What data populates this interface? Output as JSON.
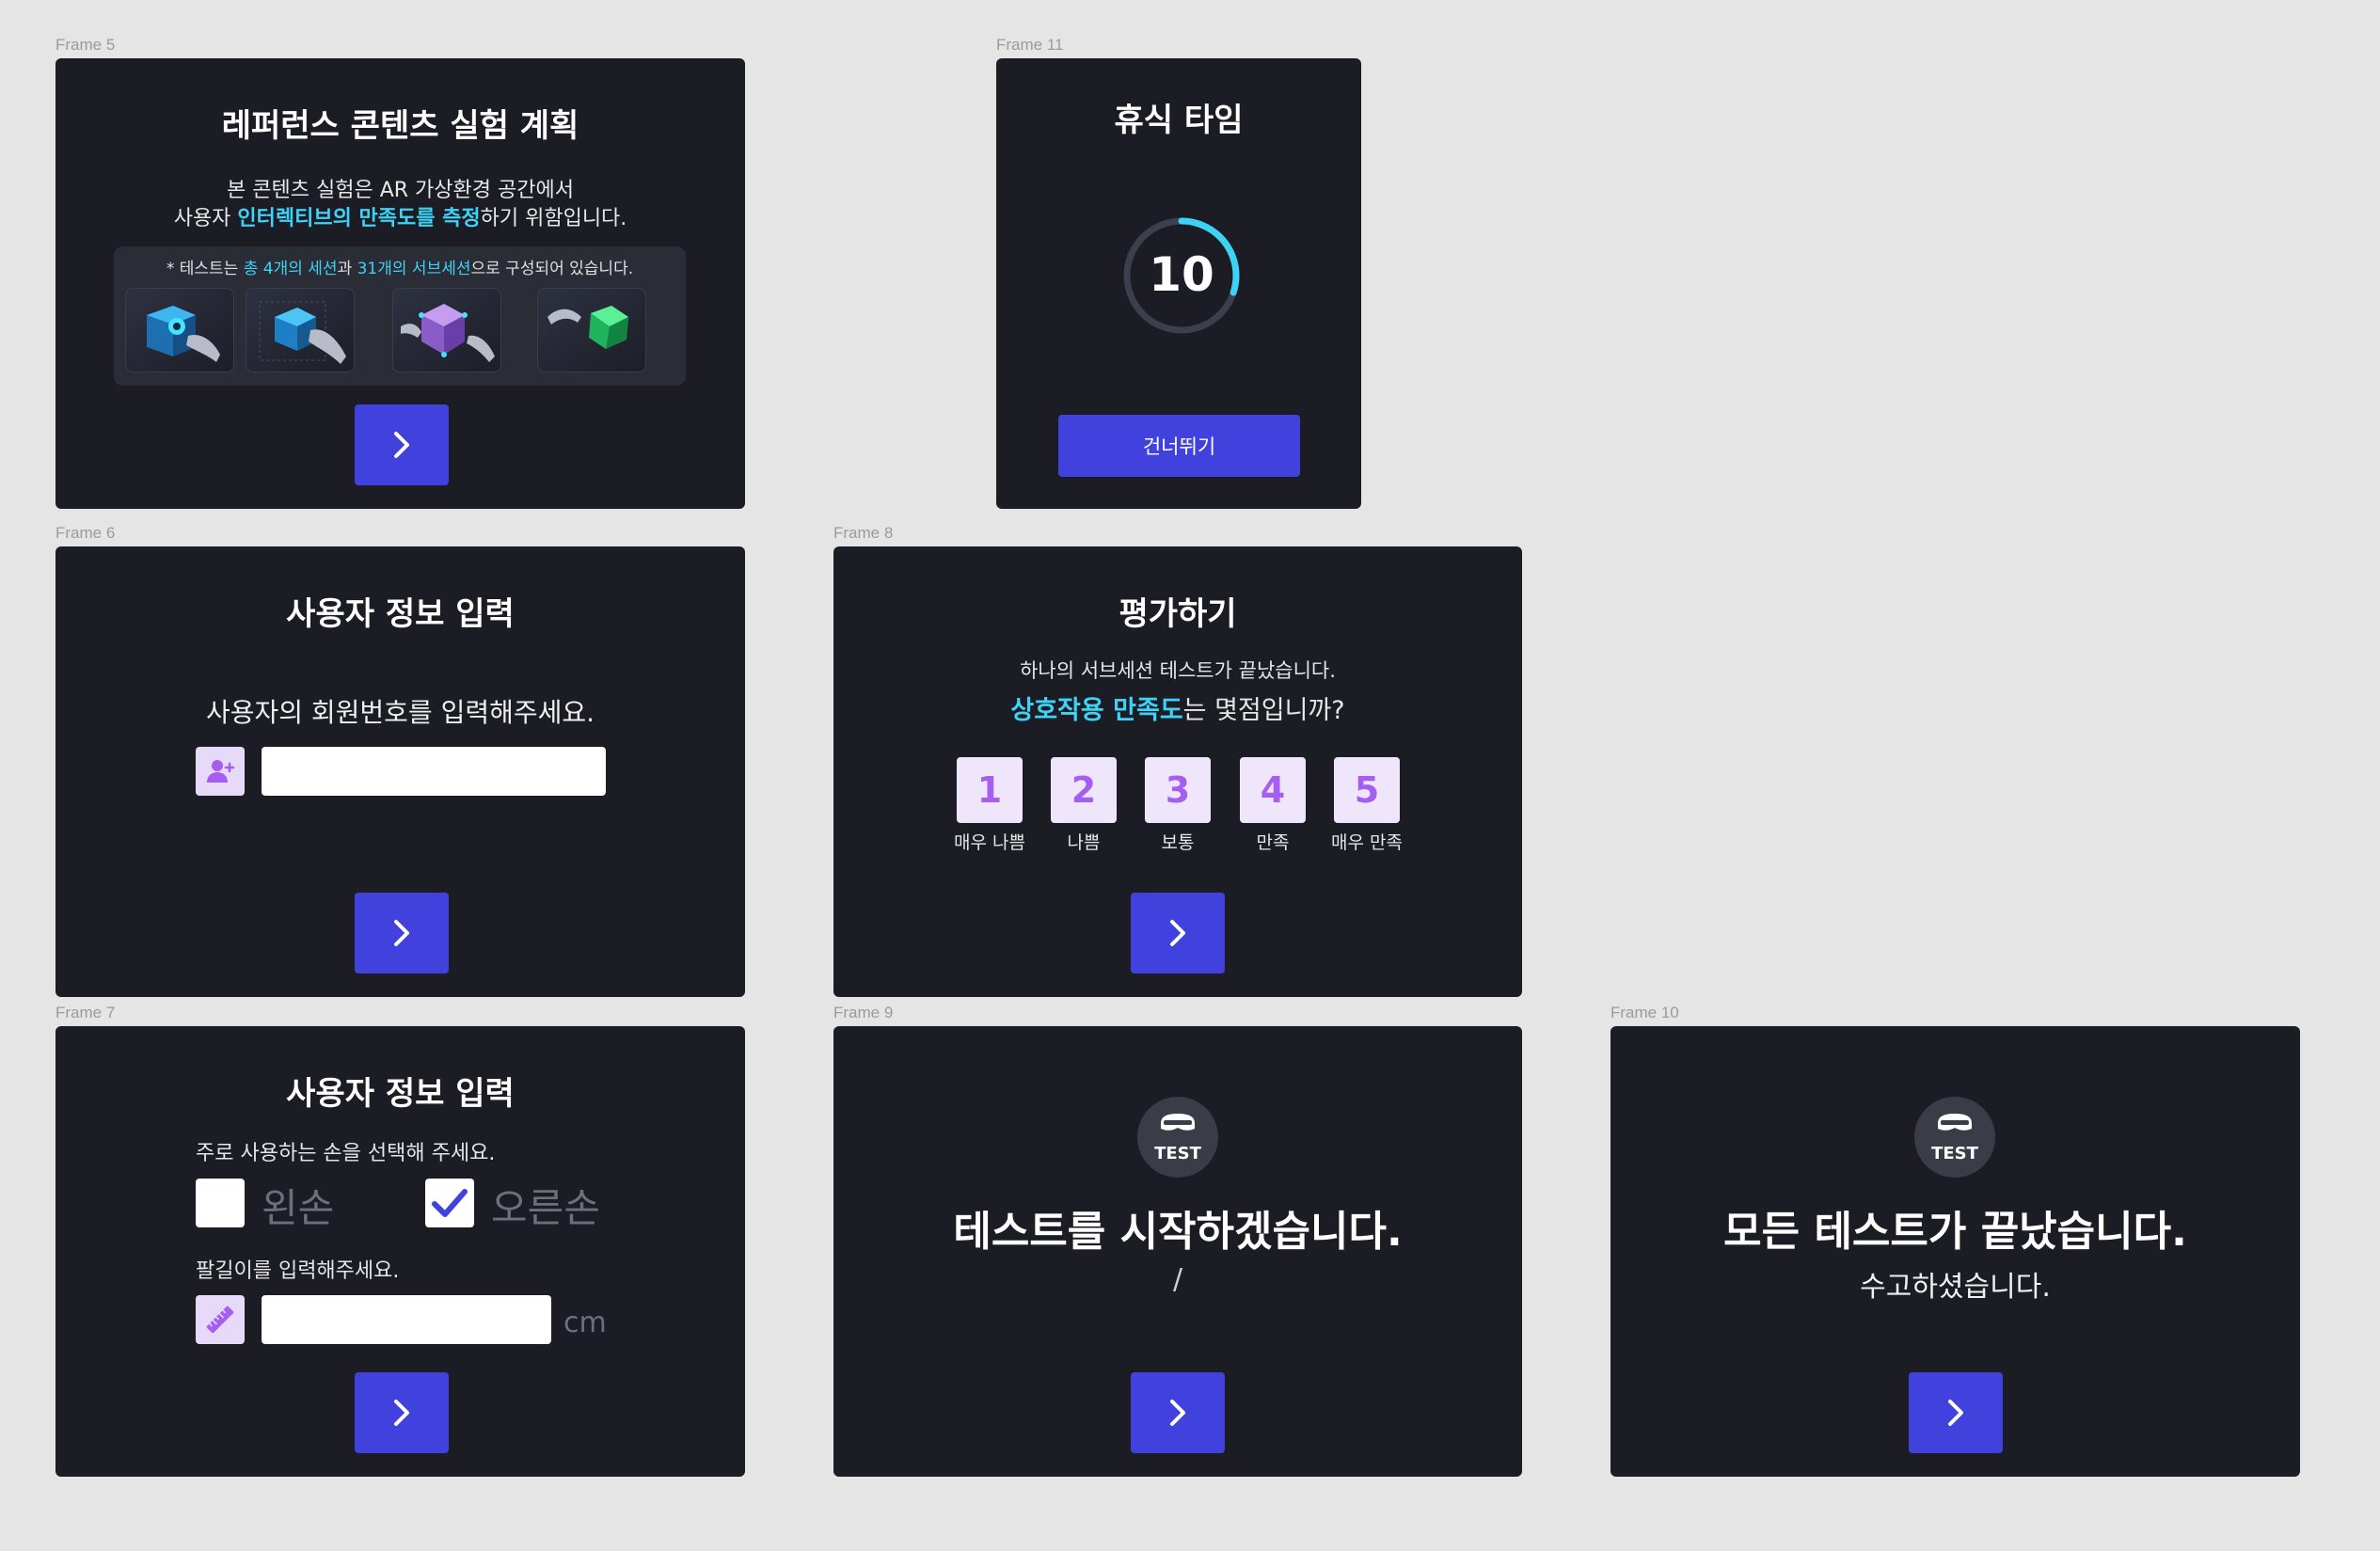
{
  "colors": {
    "background": "#e5e5e5",
    "frame": "#1c1c24",
    "accent": "#4141dd",
    "cyan": "#3ed2f6",
    "purple": "#a55ef0"
  },
  "labels": {
    "frame5": "Frame 5",
    "frame11": "Frame 11",
    "frame6": "Frame 6",
    "frame8": "Frame 8",
    "frame7": "Frame 7",
    "frame9": "Frame 9",
    "frame10": "Frame 10"
  },
  "frame5": {
    "title": "레퍼런스 콘텐츠 실험 계획",
    "line1": "본 콘텐츠 실험은 AR 가상환경 공간에서",
    "line2_pre": "사용자 ",
    "line2_hl": "인터렉티브의 만족도를 측정",
    "line2_post": "하기 위함입니다.",
    "note_pre": "* 테스트는 ",
    "note_hl1": "총 4개의 세션",
    "note_mid": "과 ",
    "note_hl2": "31개의 서브세션",
    "note_post": "으로 구성되어 있습니다."
  },
  "frame11": {
    "title": "휴식 타임",
    "timer": "10",
    "timer_progress": 0.3,
    "skip_label": "건너뛰기"
  },
  "frame6": {
    "title": "사용자 정보 입력",
    "prompt": "사용자의 회원번호를 입력해주세요.",
    "input_value": ""
  },
  "frame8": {
    "title": "평가하기",
    "line1": "하나의 서브세션 테스트가 끝났습니다.",
    "line2_hl": "상호작용 만족도",
    "line2_post": "는 몇점입니까?",
    "ratings": [
      {
        "num": "1",
        "label": "매우 나쁨"
      },
      {
        "num": "2",
        "label": "나쁨"
      },
      {
        "num": "3",
        "label": "보통"
      },
      {
        "num": "4",
        "label": "만족"
      },
      {
        "num": "5",
        "label": "매우 만족"
      }
    ]
  },
  "frame7": {
    "title": "사용자 정보 입력",
    "hand_prompt": "주로 사용하는 손을 선택해 주세요.",
    "left_hand": "왼손",
    "left_checked": false,
    "right_hand": "오른손",
    "right_checked": true,
    "arm_prompt": "팔길이를 입력해주세요.",
    "arm_value": "",
    "unit": "cm"
  },
  "frame9": {
    "badge": "TEST",
    "heading": "테스트를 시작하겠습니다.",
    "sub": "/"
  },
  "frame10": {
    "badge": "TEST",
    "heading": "모든 테스트가 끝났습니다.",
    "sub": "수고하셨습니다."
  }
}
